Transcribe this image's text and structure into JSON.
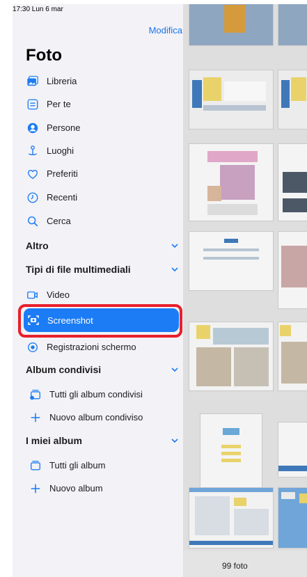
{
  "status": {
    "time": "17:30  Lun 6 mar"
  },
  "sidebar": {
    "edit_label": "Modifica",
    "title": "Foto",
    "main_items": [
      {
        "label": "Libreria",
        "icon": "photo-library-icon"
      },
      {
        "label": "Per te",
        "icon": "for-you-icon"
      },
      {
        "label": "Persone",
        "icon": "person-icon"
      },
      {
        "label": "Luoghi",
        "icon": "map-pin-icon"
      },
      {
        "label": "Preferiti",
        "icon": "heart-icon"
      },
      {
        "label": "Recenti",
        "icon": "clock-icon"
      },
      {
        "label": "Cerca",
        "icon": "search-icon"
      }
    ],
    "sections": {
      "altro": "Altro",
      "media_types": "Tipi di file multimediali",
      "shared_albums": "Album condivisi",
      "my_albums": "I miei album"
    },
    "media_items": [
      {
        "label": "Video",
        "icon": "video-icon"
      },
      {
        "label": "Screenshot",
        "icon": "screenshot-icon",
        "selected": true
      },
      {
        "label": "Registrazioni schermo",
        "icon": "screen-recording-icon"
      }
    ],
    "shared_items": [
      {
        "label": "Tutti gli album condivisi",
        "icon": "shared-album-icon"
      },
      {
        "label": "Nuovo album condiviso",
        "icon": "plus-icon"
      }
    ],
    "album_items": [
      {
        "label": "Tutti gli album",
        "icon": "album-icon"
      },
      {
        "label": "Nuovo album",
        "icon": "plus-icon"
      }
    ]
  },
  "gallery": {
    "count_label": "99 foto"
  },
  "colors": {
    "accent": "#1b7cf5",
    "highlight": "#e8202a",
    "sidebar_bg": "#f2f2f7"
  }
}
